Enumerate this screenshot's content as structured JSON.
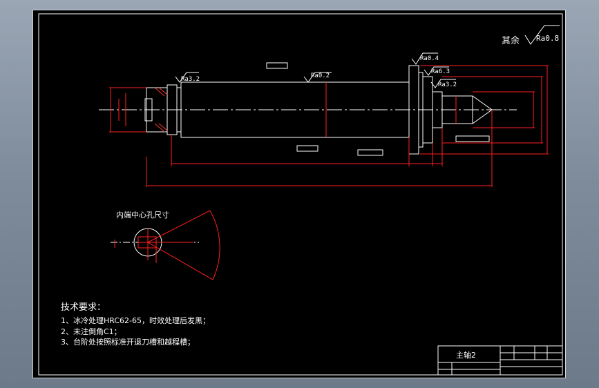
{
  "drawing": {
    "surface_rest": {
      "prefix": "其余",
      "ra": "Ra0.8"
    },
    "roughness": {
      "r1": "Ra3.2",
      "r2": "Ra0.2",
      "r3": "Ra0.4",
      "r4": "Ra6.3",
      "r5": "Ra3.2"
    },
    "detail_label": "内端中心孔尺寸",
    "tech_req": {
      "title": "技术要求：",
      "items": [
        "1、冰冷处理HRC62-65，时效处理后发黑；",
        "2、未注倒角C1；",
        "3、台阶处按照标准开退刀槽和越程槽；"
      ]
    },
    "title_block": {
      "part_name": "主轴2"
    }
  },
  "colors": {
    "sheet_bg": "#000000",
    "line": "#ffffff",
    "dimension": "#ff2020",
    "centerline": "#ffffff"
  }
}
